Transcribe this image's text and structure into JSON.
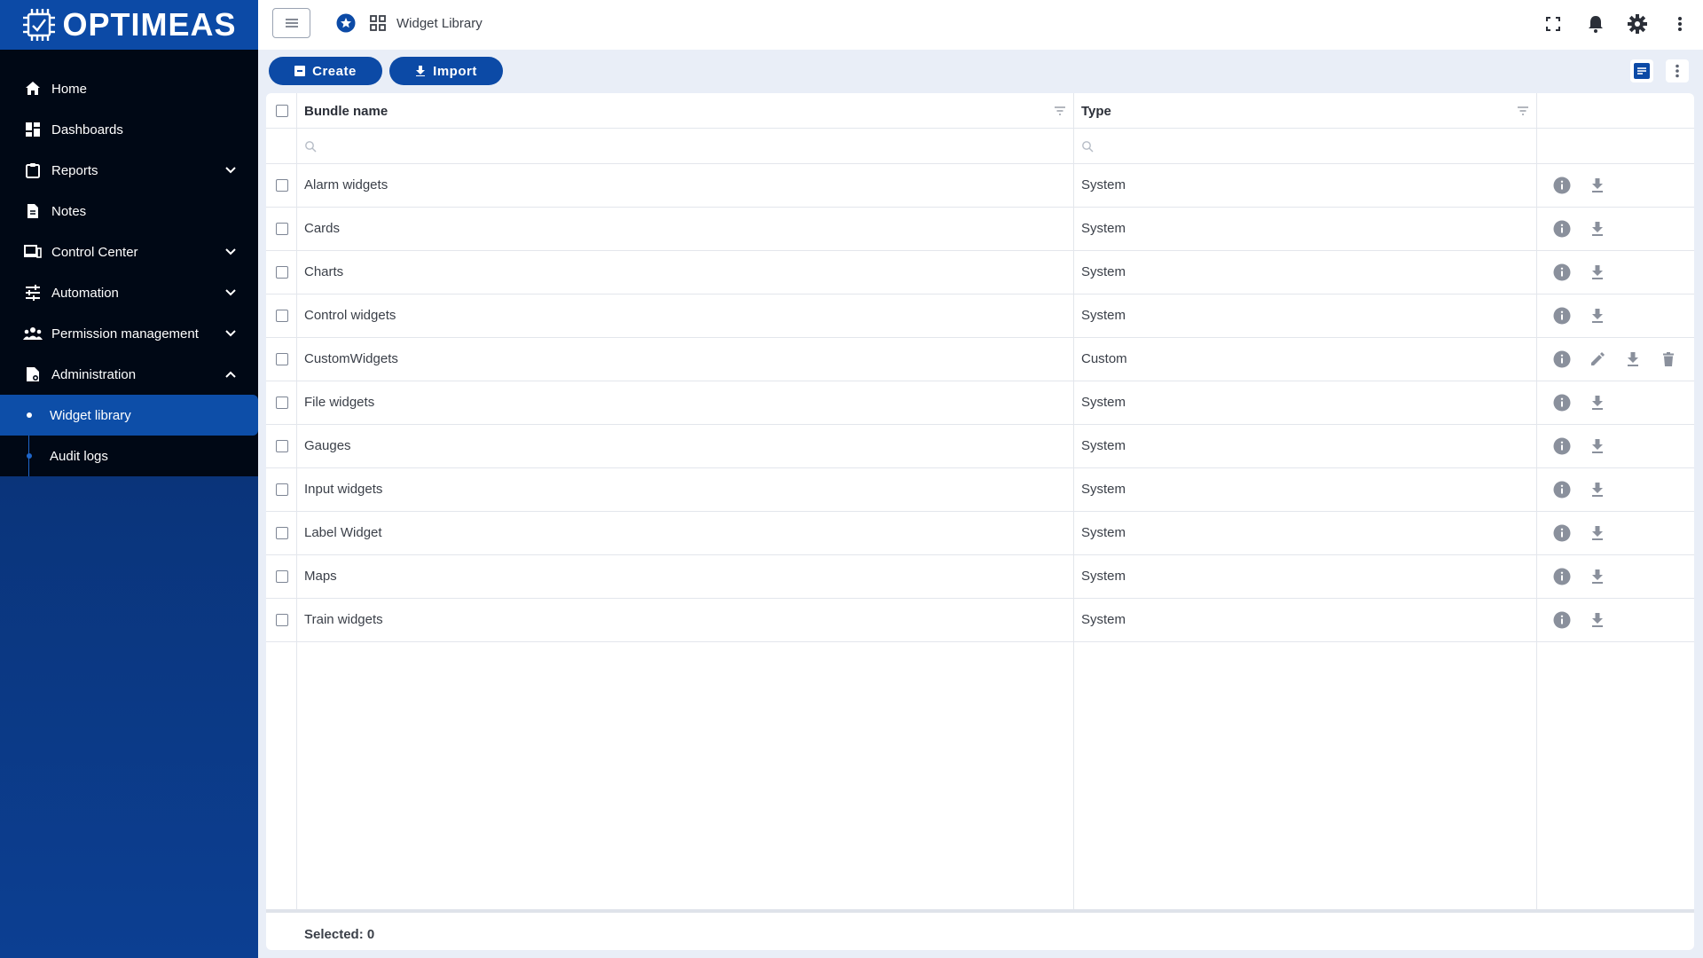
{
  "brand": {
    "name": "OPTIMEAS"
  },
  "sidebar": {
    "items": [
      {
        "label": "Home",
        "icon": "home-icon"
      },
      {
        "label": "Dashboards",
        "icon": "dashboard-icon"
      },
      {
        "label": "Reports",
        "icon": "clipboard-icon",
        "expandable": true
      },
      {
        "label": "Notes",
        "icon": "note-icon"
      },
      {
        "label": "Control Center",
        "icon": "devices-icon",
        "expandable": true
      },
      {
        "label": "Automation",
        "icon": "sliders-icon",
        "expandable": true
      },
      {
        "label": "Permission management",
        "icon": "people-icon",
        "expandable": true
      },
      {
        "label": "Administration",
        "icon": "admin-icon",
        "expanded": true
      }
    ],
    "subitems": [
      {
        "label": "Widget library",
        "active": true
      },
      {
        "label": "Audit logs",
        "active": false
      }
    ]
  },
  "topbar": {
    "breadcrumb": "Widget Library"
  },
  "toolbar": {
    "create_label": "Create",
    "import_label": "Import"
  },
  "table": {
    "columns": [
      "Bundle name",
      "Type"
    ],
    "rows": [
      {
        "name": "Alarm widgets",
        "type": "System",
        "custom": false
      },
      {
        "name": "Cards",
        "type": "System",
        "custom": false
      },
      {
        "name": "Charts",
        "type": "System",
        "custom": false
      },
      {
        "name": "Control widgets",
        "type": "System",
        "custom": false
      },
      {
        "name": "CustomWidgets",
        "type": "Custom",
        "custom": true
      },
      {
        "name": "File widgets",
        "type": "System",
        "custom": false
      },
      {
        "name": "Gauges",
        "type": "System",
        "custom": false
      },
      {
        "name": "Input widgets",
        "type": "System",
        "custom": false
      },
      {
        "name": "Label Widget",
        "type": "System",
        "custom": false
      },
      {
        "name": "Maps",
        "type": "System",
        "custom": false
      },
      {
        "name": "Train widgets",
        "type": "System",
        "custom": false
      }
    ],
    "selected_label": "Selected: 0"
  },
  "colors": {
    "primary": "#0c4aa6",
    "sidebar_dark": "#000815",
    "icon_gray": "#8a909c"
  }
}
